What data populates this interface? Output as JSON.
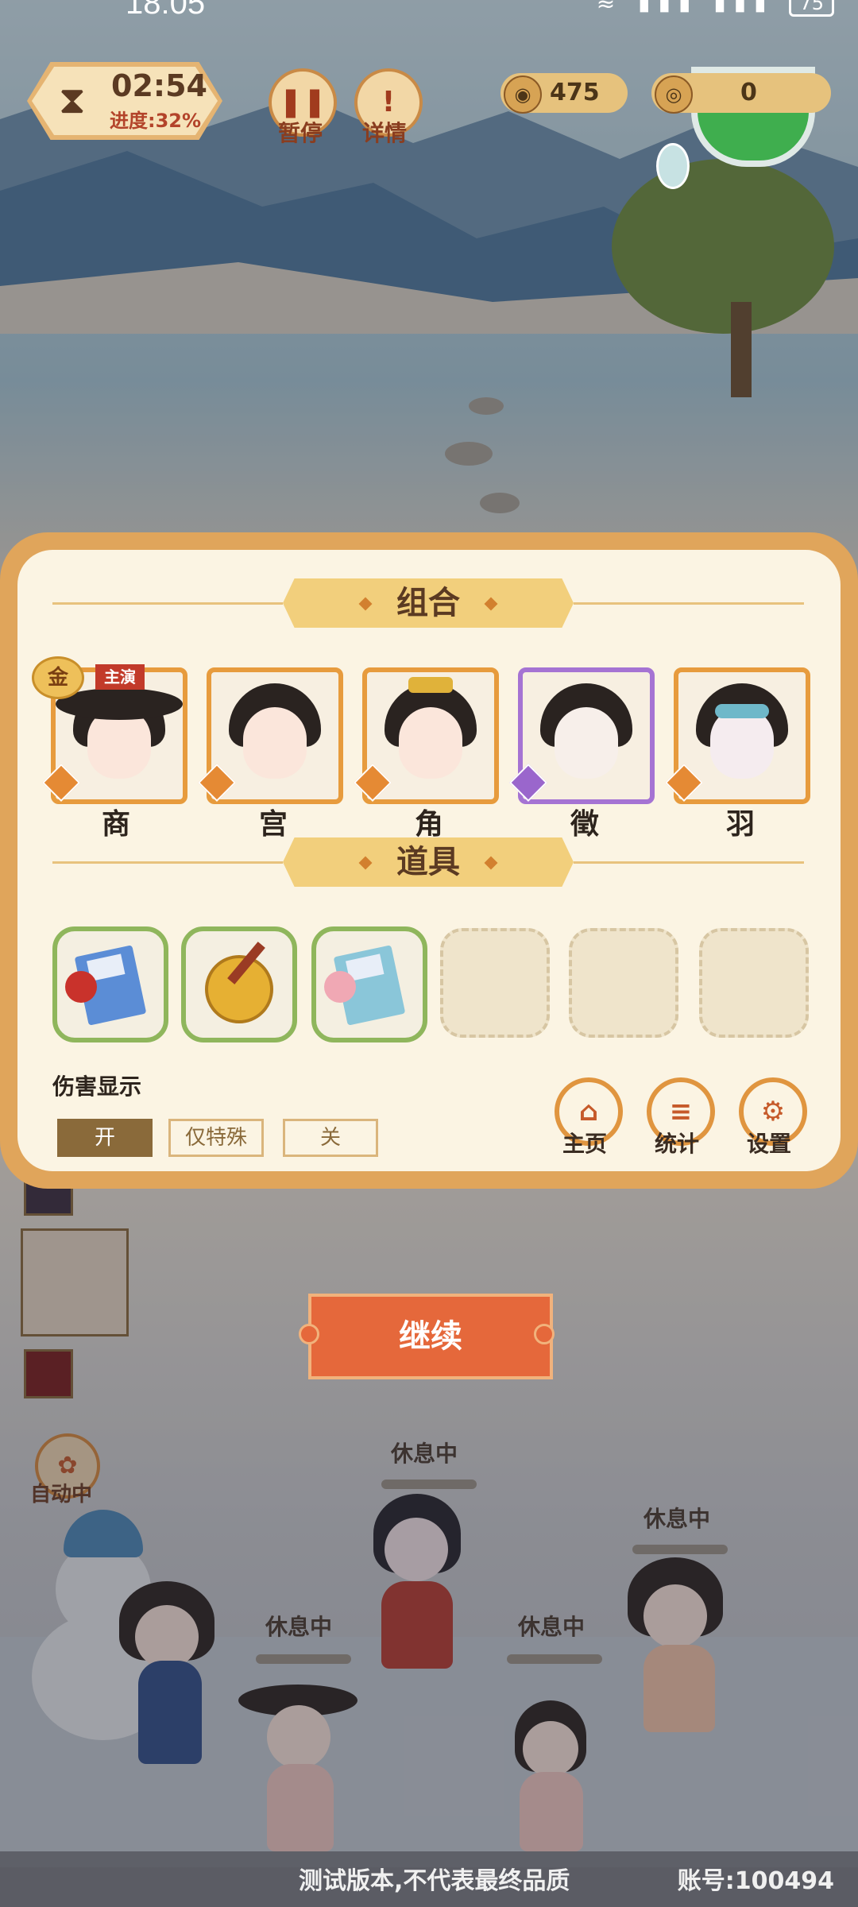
{
  "status_bar": {
    "time": "18:05",
    "battery": "75"
  },
  "hud": {
    "timer": "02:54",
    "progress": "进度:32%",
    "pause_label": "暂停",
    "details_label": "详情",
    "currency_1": "475",
    "currency_2": "0",
    "pause_icon": "pause-icon",
    "details_icon": "exclamation-icon"
  },
  "panel": {
    "team_title": "组合",
    "items_title": "道具",
    "lead_badge": "主演",
    "gold_badge": "金",
    "characters": [
      {
        "name": "商",
        "role": "scroll-role"
      },
      {
        "name": "宫",
        "role": "purse-role"
      },
      {
        "name": "角",
        "role": "trident-role"
      },
      {
        "name": "徵",
        "role": "staff-role"
      },
      {
        "name": "羽",
        "role": "brush-role"
      }
    ],
    "items": [
      {
        "icon": "red-flower-book-icon"
      },
      {
        "icon": "pipa-lute-icon"
      },
      {
        "icon": "pink-flower-book-icon"
      },
      {
        "icon": "empty-slot"
      },
      {
        "icon": "empty-slot"
      },
      {
        "icon": "empty-slot"
      }
    ],
    "damage_display_label": "伤害显示",
    "damage_options": [
      "开",
      "仅特殊",
      "关"
    ],
    "damage_selected": "开",
    "nav": {
      "home_label": "主页",
      "stats_label": "统计",
      "settings_label": "设置"
    }
  },
  "continue_label": "继续",
  "auto_label": "自动中",
  "rest_labels": [
    "休息中",
    "休息中",
    "休息中",
    "休息中"
  ],
  "footer": {
    "notice": "测试版本,不代表最终品质",
    "account": "账号:100494"
  },
  "colors": {
    "panel_border": "#e0a55b",
    "panel_bg": "#fbf4e3",
    "accent_orange": "#e5683b",
    "card_orange": "#e79b3d",
    "card_purple": "#a573d3",
    "item_green": "#8fb65c"
  }
}
